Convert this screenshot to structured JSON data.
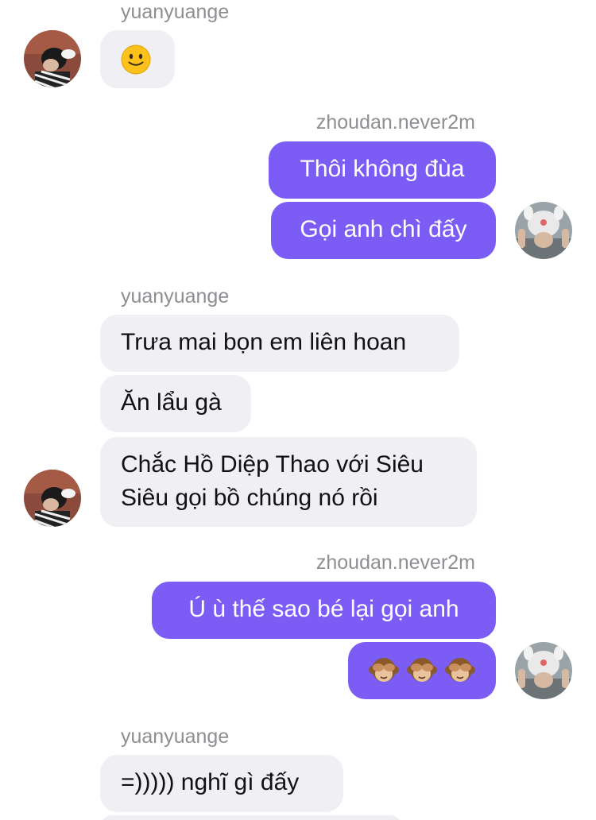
{
  "messages": {
    "s1_sender": "yuanyuange",
    "m1_emoji": "slightly-smiling-face",
    "s2_sender": "zhoudan.never2m",
    "m2_text": "Thôi không đùa",
    "m3_text": "Gọi anh chì đấy",
    "s3_sender": "yuanyuange",
    "m4_text": "Trưa mai bọn em liên hoan",
    "m5_text": "Ăn lẩu gà",
    "m6_line1": "Chắc Hồ Diệp Thao với Siêu",
    "m6_line2": "Siêu gọi bồ chúng nó rồi",
    "s4_sender": "zhoudan.never2m",
    "m7_text": "Ú ù thế sao bé lại gọi anh",
    "m8_emoji": [
      "see-no-evil-monkey",
      "see-no-evil-monkey",
      "see-no-evil-monkey"
    ],
    "s5_sender": "yuanyuange",
    "m9_text": "=))))) nghĩ gì đấy"
  },
  "colors": {
    "incoming_bubble": "#efeff4",
    "outgoing_bubble": "#7b5cf5",
    "sender_name": "#8e8e93",
    "text_dark": "#111111",
    "text_light": "#ffffff"
  }
}
